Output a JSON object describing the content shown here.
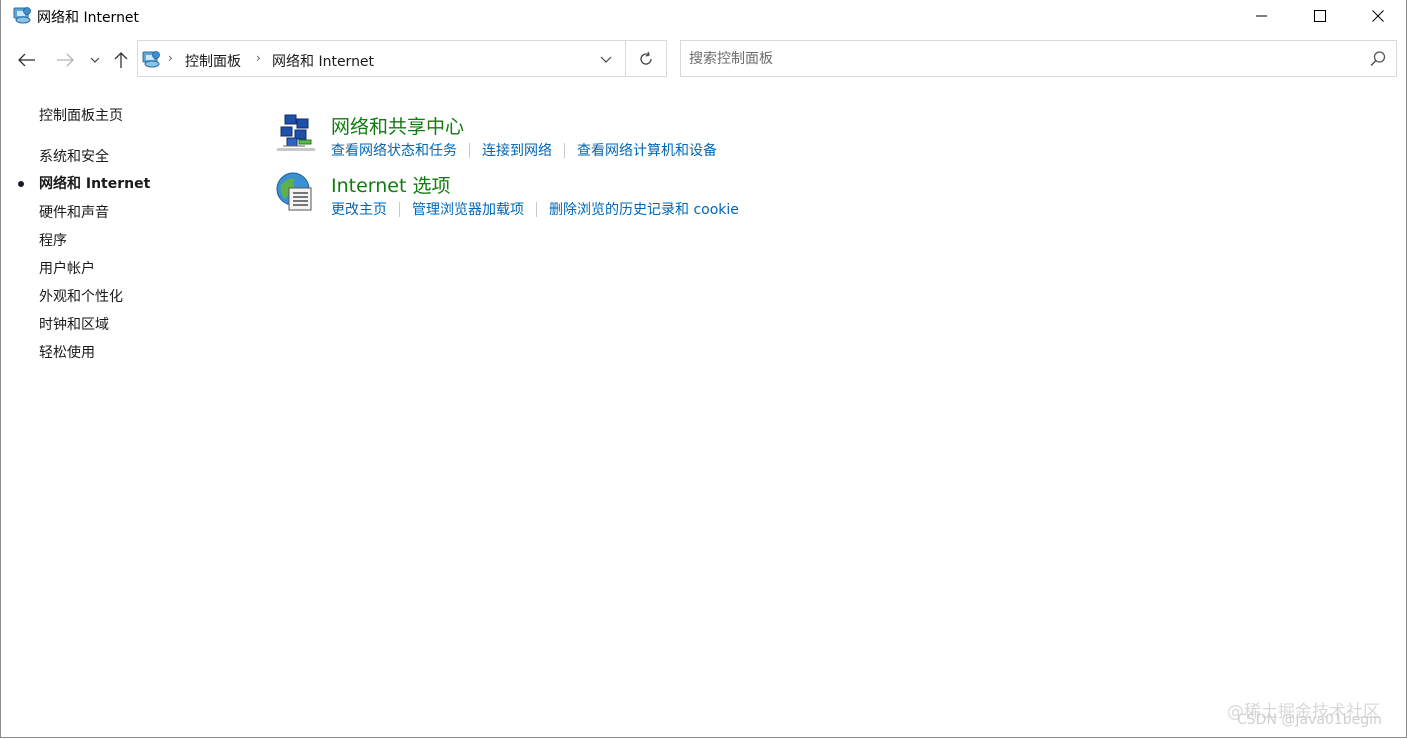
{
  "window": {
    "title": "网络和 Internet",
    "controls": {
      "minimize_icon": "minimize-icon",
      "maximize_icon": "maximize-icon",
      "close_icon": "close-icon"
    }
  },
  "nav": {
    "back_icon": "arrow-left-icon",
    "forward_icon": "arrow-right-icon",
    "recent_icon": "chevron-down-icon",
    "up_icon": "arrow-up-icon",
    "breadcrumb": [
      "控制面板",
      "网络和 Internet"
    ],
    "refresh_icon": "refresh-icon",
    "search_placeholder": "搜索控制面板"
  },
  "sidebar": {
    "items": [
      {
        "label": "控制面板主页",
        "active": false
      },
      {
        "label": "系统和安全",
        "active": false
      },
      {
        "label": "网络和 Internet",
        "active": true
      },
      {
        "label": "硬件和声音",
        "active": false
      },
      {
        "label": "程序",
        "active": false
      },
      {
        "label": "用户帐户",
        "active": false
      },
      {
        "label": "外观和个性化",
        "active": false
      },
      {
        "label": "时钟和区域",
        "active": false
      },
      {
        "label": "轻松使用",
        "active": false
      }
    ]
  },
  "categories": [
    {
      "title": "网络和共享中心",
      "icon": "network-sharing-center-icon",
      "links": [
        "查看网络状态和任务",
        "连接到网络",
        "查看网络计算机和设备"
      ]
    },
    {
      "title": "Internet 选项",
      "icon": "internet-options-icon",
      "links": [
        "更改主页",
        "管理浏览器加载项",
        "删除浏览的历史记录和 cookie"
      ]
    }
  ],
  "watermark": {
    "line1": "@稀土掘金技术社区",
    "line2": "CSDN @Java01begin"
  },
  "colors": {
    "category_title": "#107c10",
    "link": "#0067b8",
    "text": "#1a1a1a"
  }
}
